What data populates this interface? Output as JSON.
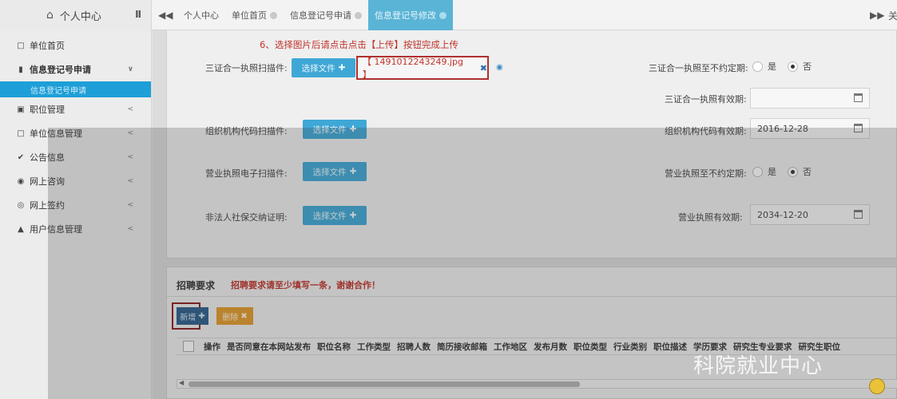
{
  "header": {
    "brand": "个人中心",
    "tabs": [
      {
        "label": "个人中心"
      },
      {
        "label": "单位首页"
      },
      {
        "label": "信息登记号申请"
      },
      {
        "label": "信息登记号修改"
      }
    ],
    "close_all": "关"
  },
  "sidebar": {
    "items": [
      {
        "label": "单位首页",
        "icon": "square-icon"
      },
      {
        "label": "信息登记号申请",
        "icon": "file-icon"
      },
      {
        "label": "信息登记号申请"
      },
      {
        "label": "职位管理",
        "icon": "checkbox-icon"
      },
      {
        "label": "单位信息管理",
        "icon": "square-icon"
      },
      {
        "label": "公告信息",
        "icon": "check-icon"
      },
      {
        "label": "网上咨询",
        "icon": "circle-icon"
      },
      {
        "label": "网上签约",
        "icon": "eye-icon"
      },
      {
        "label": "用户信息管理",
        "icon": "bell-icon"
      }
    ]
  },
  "form": {
    "hint": "6、选择图片后请点击点击【上传】按钮完成上传",
    "upload_label": "选择文件",
    "three_in_one_label": "三证合一执照扫描件:",
    "file_name": "【 1491012243249.jpg 】",
    "three_in_one_unlimited_label": "三证合一执照至不约定期:",
    "yes": "是",
    "no": "否",
    "three_in_one_valid_label": "三证合一执照有效期:",
    "three_in_one_valid_value": "",
    "org_code_scan_label": "组织机构代码扫描件:",
    "org_code_valid_label": "组织机构代码有效期:",
    "org_code_valid_value": "2016-12-28",
    "license_scan_label": "营业执照电子扫描件:",
    "license_unlimited_label": "营业执照至不约定期:",
    "social_security_label": "非法人社保交纳证明:",
    "license_valid_label": "营业执照有效期:",
    "license_valid_value": "2034-12-20"
  },
  "recruit": {
    "title": "招聘要求",
    "note": "招聘要求请至少填写一条，谢谢合作！",
    "add_label": "新增",
    "delete_label": "删除",
    "columns": [
      "操作",
      "是否同意在本网站发布",
      "职位名称",
      "工作类型",
      "招聘人数",
      "简历接收邮箱",
      "工作地区",
      "发布月数",
      "职位类型",
      "行业类别",
      "职位描述",
      "学历要求",
      "研究生专业要求",
      "研究生职位"
    ]
  },
  "watermark": "科院就业中心"
}
